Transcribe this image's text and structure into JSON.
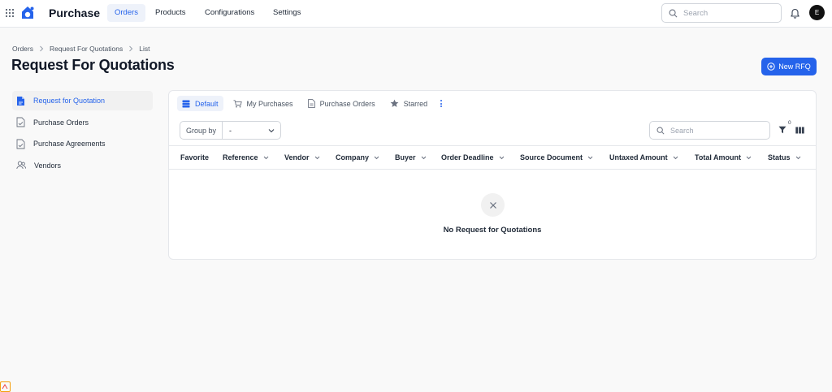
{
  "app": {
    "title": "Purchase",
    "user_initial": "E"
  },
  "nav": [
    {
      "label": "Orders",
      "active": true
    },
    {
      "label": "Products",
      "active": false
    },
    {
      "label": "Configurations",
      "active": false
    },
    {
      "label": "Settings",
      "active": false
    }
  ],
  "top_search": {
    "placeholder": "Search"
  },
  "breadcrumb": [
    "Orders",
    "Request For Quotations",
    "List"
  ],
  "page": {
    "title": "Request For Quotations",
    "new_button": "New RFQ"
  },
  "sidebar": {
    "items": [
      {
        "label": "Request for Quotation",
        "icon": "document-icon",
        "active": true
      },
      {
        "label": "Purchase Orders",
        "icon": "document-check-icon",
        "active": false
      },
      {
        "label": "Purchase Agreements",
        "icon": "document-check-icon",
        "active": false
      },
      {
        "label": "Vendors",
        "icon": "users-icon",
        "active": false
      }
    ]
  },
  "tabs": [
    {
      "label": "Default",
      "icon": "stack-icon",
      "active": true
    },
    {
      "label": "My Purchases",
      "icon": "cart-icon",
      "active": false
    },
    {
      "label": "Purchase Orders",
      "icon": "document-icon",
      "active": false
    },
    {
      "label": "Starred",
      "icon": "star-icon",
      "active": false
    }
  ],
  "toolbar": {
    "group_by_label": "Group by",
    "group_by_value": "-",
    "search_placeholder": "Search",
    "filter_count": "0"
  },
  "columns": [
    "Favorite",
    "Reference",
    "Vendor",
    "Company",
    "Buyer",
    "Order Deadline",
    "Source Document",
    "Untaxed Amount",
    "Total Amount",
    "Status"
  ],
  "empty_state": {
    "message": "No Request for Quotations"
  },
  "colors": {
    "accent": "#2563eb",
    "accent_bg": "#eef2fa",
    "border": "#e5e7eb",
    "page_bg": "#f9f9f9"
  }
}
